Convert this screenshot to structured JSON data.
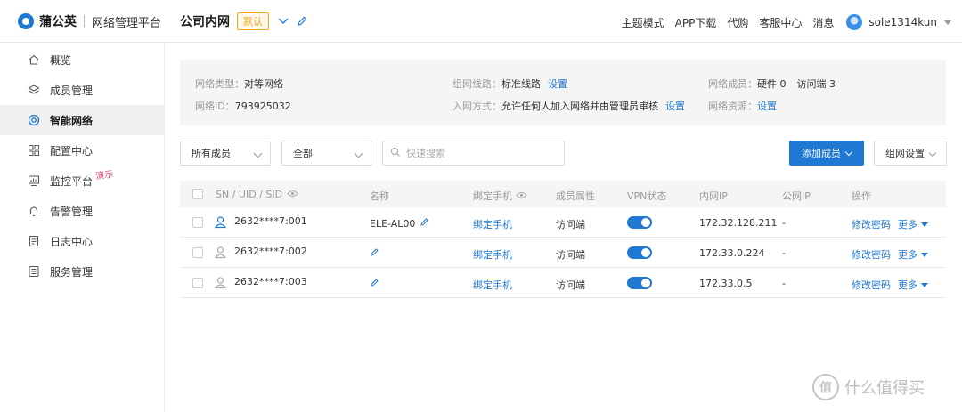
{
  "brand": {
    "name": "蒲公英",
    "subtitle": "网络管理平台"
  },
  "network": {
    "name": "公司内网",
    "default_badge": "默认"
  },
  "top_links": [
    "主题模式",
    "APP下载",
    "代购",
    "客服中心",
    "消息"
  ],
  "user": {
    "name": "sole1314kun"
  },
  "sidebar": {
    "items": [
      {
        "label": "概览",
        "icon": "home-icon"
      },
      {
        "label": "成员管理",
        "icon": "layers-icon"
      },
      {
        "label": "智能网络",
        "icon": "network-icon",
        "active": true
      },
      {
        "label": "配置中心",
        "icon": "grid-icon"
      },
      {
        "label": "监控平台",
        "icon": "monitor-icon",
        "badge": "演示"
      },
      {
        "label": "告警管理",
        "icon": "bell-icon"
      },
      {
        "label": "日志中心",
        "icon": "log-icon"
      },
      {
        "label": "服务管理",
        "icon": "service-icon"
      }
    ]
  },
  "info": {
    "type_label": "网络类型：",
    "type_value": "对等网络",
    "line_label": "组网线路：",
    "line_value": "标准线路",
    "line_link": "设置",
    "members_label": "网络成员：",
    "members_hw": "硬件 0",
    "members_visitor": "访问端 3",
    "id_label": "网络ID：",
    "id_value": "793925032",
    "join_label": "入网方式：",
    "join_value": "允许任何人加入网络并由管理员审核",
    "join_link": "设置",
    "resource_label": "网络资源：",
    "resource_link": "设置"
  },
  "filters": {
    "member_select": "所有成员",
    "status_select": "全部",
    "search_placeholder": "快速搜索",
    "add_button": "添加成员",
    "settings_button": "组网设置"
  },
  "table": {
    "headers": {
      "sn": "SN / UID / SID",
      "name": "名称",
      "phone": "绑定手机",
      "attr": "成员属性",
      "vpn": "VPN状态",
      "ip": "内网IP",
      "public_ip": "公网IP",
      "action": "操作"
    },
    "rows": [
      {
        "sn": "2632****7:001",
        "name": "ELE-AL00",
        "phone": "绑定手机",
        "attr": "访问端",
        "vpn": "on",
        "ip": "172.32.128.211",
        "public_ip": "-",
        "action": "修改密码",
        "more": "更多",
        "online": true
      },
      {
        "sn": "2632****7:002",
        "name": "",
        "phone": "绑定手机",
        "attr": "访问端",
        "vpn": "on",
        "ip": "172.33.0.224",
        "public_ip": "-",
        "action": "修改密码",
        "more": "更多",
        "online": false
      },
      {
        "sn": "2632****7:003",
        "name": "",
        "phone": "绑定手机",
        "attr": "访问端",
        "vpn": "on",
        "ip": "172.33.0.5",
        "public_ip": "-",
        "action": "修改密码",
        "more": "更多",
        "online": false
      }
    ]
  },
  "watermark": {
    "text": "什么值得买",
    "mark": "值"
  },
  "colors": {
    "accent": "#1f78d1",
    "badge": "#f5a623",
    "demo": "#e8467c"
  }
}
